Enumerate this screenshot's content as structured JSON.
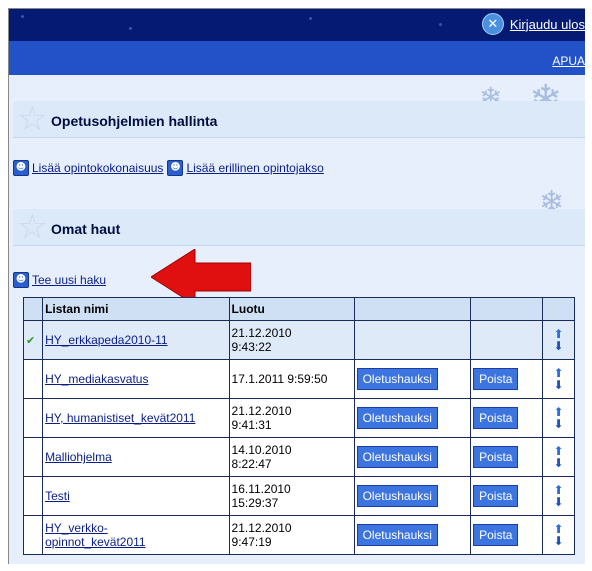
{
  "topbar": {
    "logout_label": "Kirjaudu ulos"
  },
  "navbar": {
    "help_label": "APUA"
  },
  "section1": {
    "title": "Opetusohjelmien hallinta"
  },
  "links": {
    "add_study_unit": "Lisää opintokokonaisuus",
    "add_course": "Lisää erillinen opintojakso"
  },
  "section2": {
    "title": "Omat haut"
  },
  "new_search": {
    "label": "Tee uusi haku"
  },
  "table": {
    "headers": [
      "Listan nimi",
      "Luotu"
    ],
    "default_button": "Oletushauksi",
    "delete_button": "Poista",
    "rows": [
      {
        "name": "HY_erkkapeda2010-11",
        "created": "21.12.2010\n9:43:22"
      },
      {
        "name": "HY_mediakasvatus",
        "created": "17.1.2011 9:59:50"
      },
      {
        "name": "HY, humanistiset_kevät2011",
        "created": "21.12.2010\n9:41:31"
      },
      {
        "name": "Malliohjelma",
        "created": "14.10.2010\n8:22:47"
      },
      {
        "name": "Testi",
        "created": "16.11.2010\n15:29:37"
      },
      {
        "name": "HY_verkko-\nopinnot_kevät2011",
        "created": "21.12.2010\n9:47:19"
      }
    ]
  },
  "colors": {
    "topbar": "#041a73",
    "navbar": "#2352c8",
    "content_bg": "#e6effb",
    "button": "#3c74e0",
    "arrow": "#e01010"
  }
}
